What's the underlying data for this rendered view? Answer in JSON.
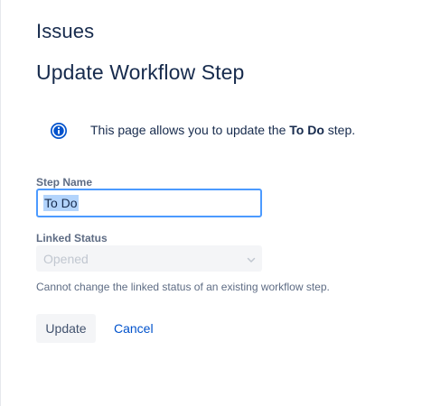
{
  "header": {
    "section_title": "Issues",
    "page_title": "Update Workflow Step"
  },
  "info": {
    "icon": "info-icon",
    "prefix": "This page allows you to update the ",
    "step_name": "To Do",
    "suffix": " step."
  },
  "form": {
    "step_name_label": "Step Name",
    "step_name_value": "To Do",
    "linked_status_label": "Linked Status",
    "linked_status_value": "Opened",
    "linked_status_helper": "Cannot change the linked status of an existing workflow step."
  },
  "actions": {
    "update_label": "Update",
    "cancel_label": "Cancel"
  },
  "colors": {
    "info_icon": "#0052cc",
    "focus_border": "#4c9aff",
    "link": "#0052cc",
    "text_primary": "#172b4d"
  }
}
